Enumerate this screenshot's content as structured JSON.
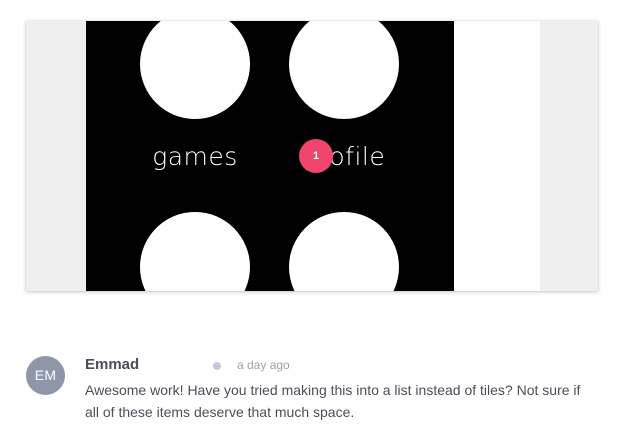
{
  "screenshot": {
    "tiles": [
      {
        "label": "games"
      },
      {
        "label": "profile"
      }
    ],
    "hotspot": {
      "number": "1",
      "color": "#f2456e"
    }
  },
  "comment": {
    "avatar_initials": "EM",
    "avatar_color": "#8e96aa",
    "author": "Emmad",
    "timestamp": "a day ago",
    "body": "Awesome work! Have you tried making this into a list instead of tiles? Not sure if all of these items deserve that much space."
  }
}
